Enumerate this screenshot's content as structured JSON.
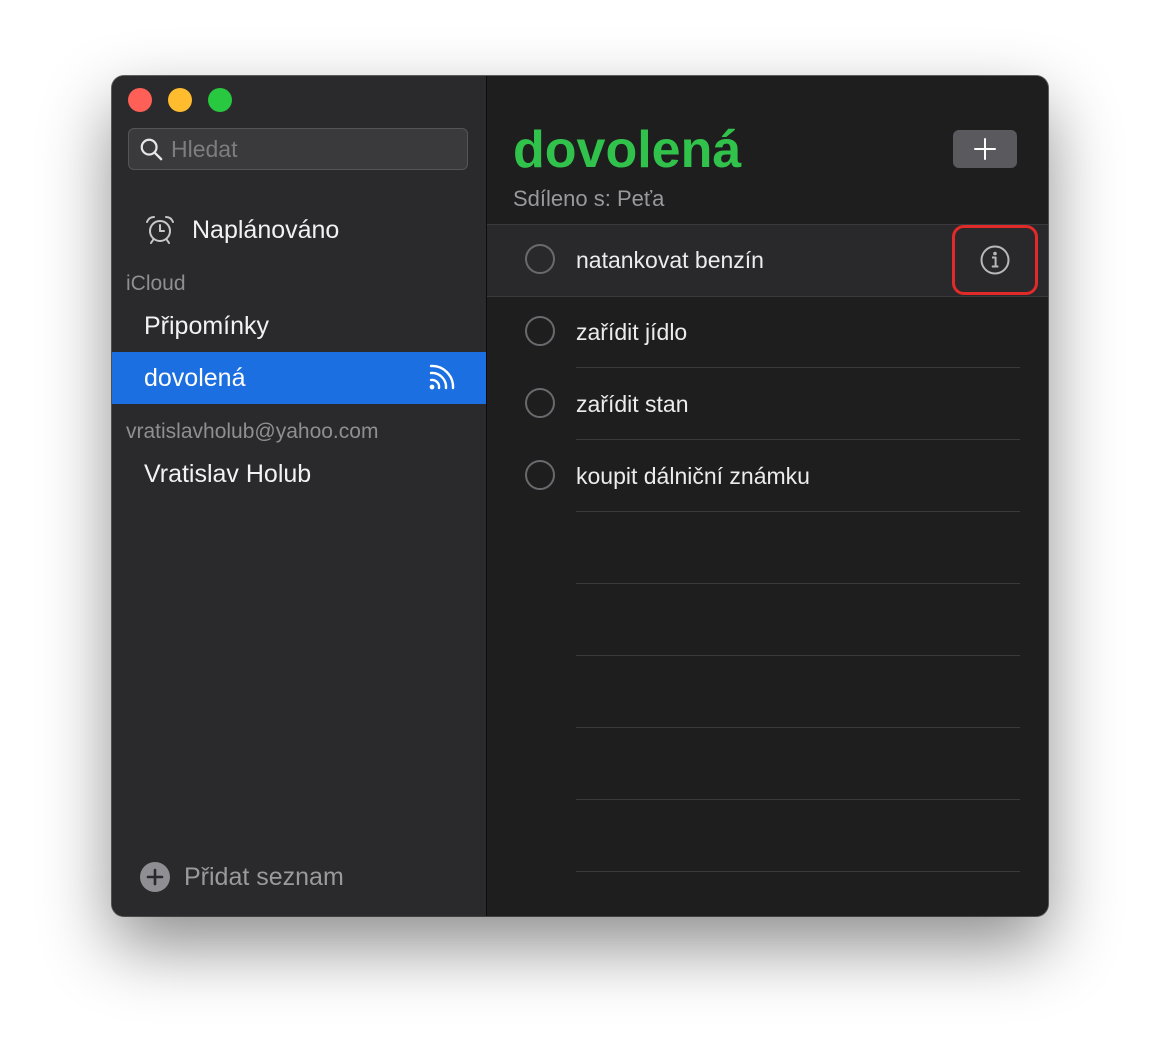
{
  "sidebar": {
    "search": {
      "placeholder": "Hledat",
      "value": ""
    },
    "scheduled_label": "Naplánováno",
    "icloud_header": "iCloud",
    "icloud_lists": [
      {
        "label": "Připomínky",
        "selected": false,
        "shared": false
      },
      {
        "label": "dovolená",
        "selected": true,
        "shared": true
      }
    ],
    "yahoo_header": "vratislavholub@yahoo.com",
    "yahoo_lists": [
      {
        "label": "Vratislav Holub",
        "selected": false
      }
    ],
    "add_list_label": "Přidat seznam"
  },
  "main": {
    "title": "dovolená",
    "shared_with": "Sdíleno s: Peťa",
    "reminders": [
      {
        "text": "natankovat benzín",
        "done": false,
        "selected": true
      },
      {
        "text": "zařídit jídlo",
        "done": false,
        "selected": false
      },
      {
        "text": "zařídit stan",
        "done": false,
        "selected": false
      },
      {
        "text": "koupit dálniční známku",
        "done": false,
        "selected": false
      }
    ]
  },
  "colors": {
    "accent_green": "#31c24c",
    "selection_blue": "#1b6fe0",
    "highlight_red": "#e12a2a",
    "traffic_close": "#fe5f57",
    "traffic_minimize": "#febc2e",
    "traffic_maximize": "#28c840"
  },
  "icons": {
    "search": "search-icon",
    "scheduled": "alarm-clock-icon",
    "shared": "shared-icon",
    "add_list": "plus-circle-icon",
    "add_reminder": "plus-icon",
    "info": "info-icon"
  }
}
